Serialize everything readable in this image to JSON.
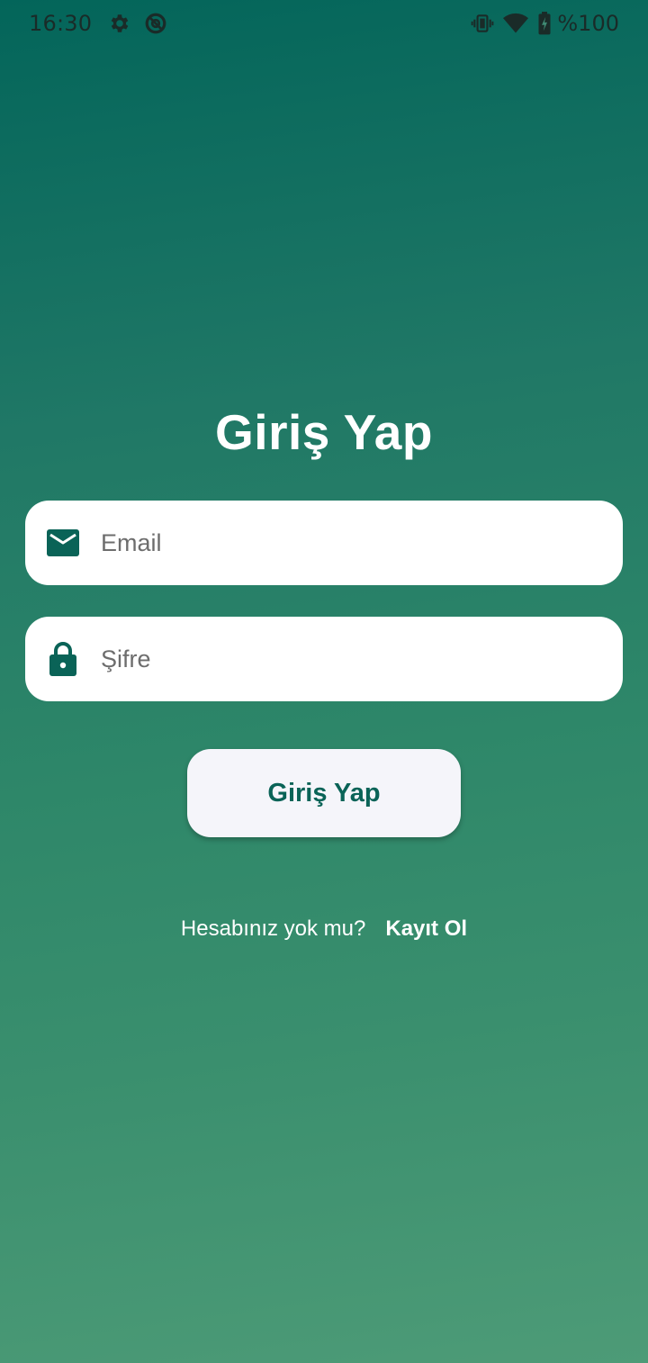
{
  "status_bar": {
    "time": "16:30",
    "left_icons": [
      "settings-icon",
      "data-saver-icon"
    ],
    "right_icons": [
      "vibrate-icon",
      "wifi-icon",
      "battery-charging-icon"
    ],
    "battery": "%100"
  },
  "login": {
    "title": "Giriş Yap",
    "email_placeholder": "Email",
    "email_value": "",
    "email_icon": "mail-icon",
    "password_placeholder": "Şifre",
    "password_value": "",
    "password_icon": "lock-icon",
    "submit_label": "Giriş Yap",
    "register_prompt": "Hesabınız yok mu?",
    "register_link": "Kayıt Ol"
  },
  "colors": {
    "gradient_top": "#03655a",
    "gradient_bottom": "#4d9b77",
    "accent": "#0a6357",
    "field_background": "#ffffff",
    "button_background": "#f5f5fa"
  }
}
